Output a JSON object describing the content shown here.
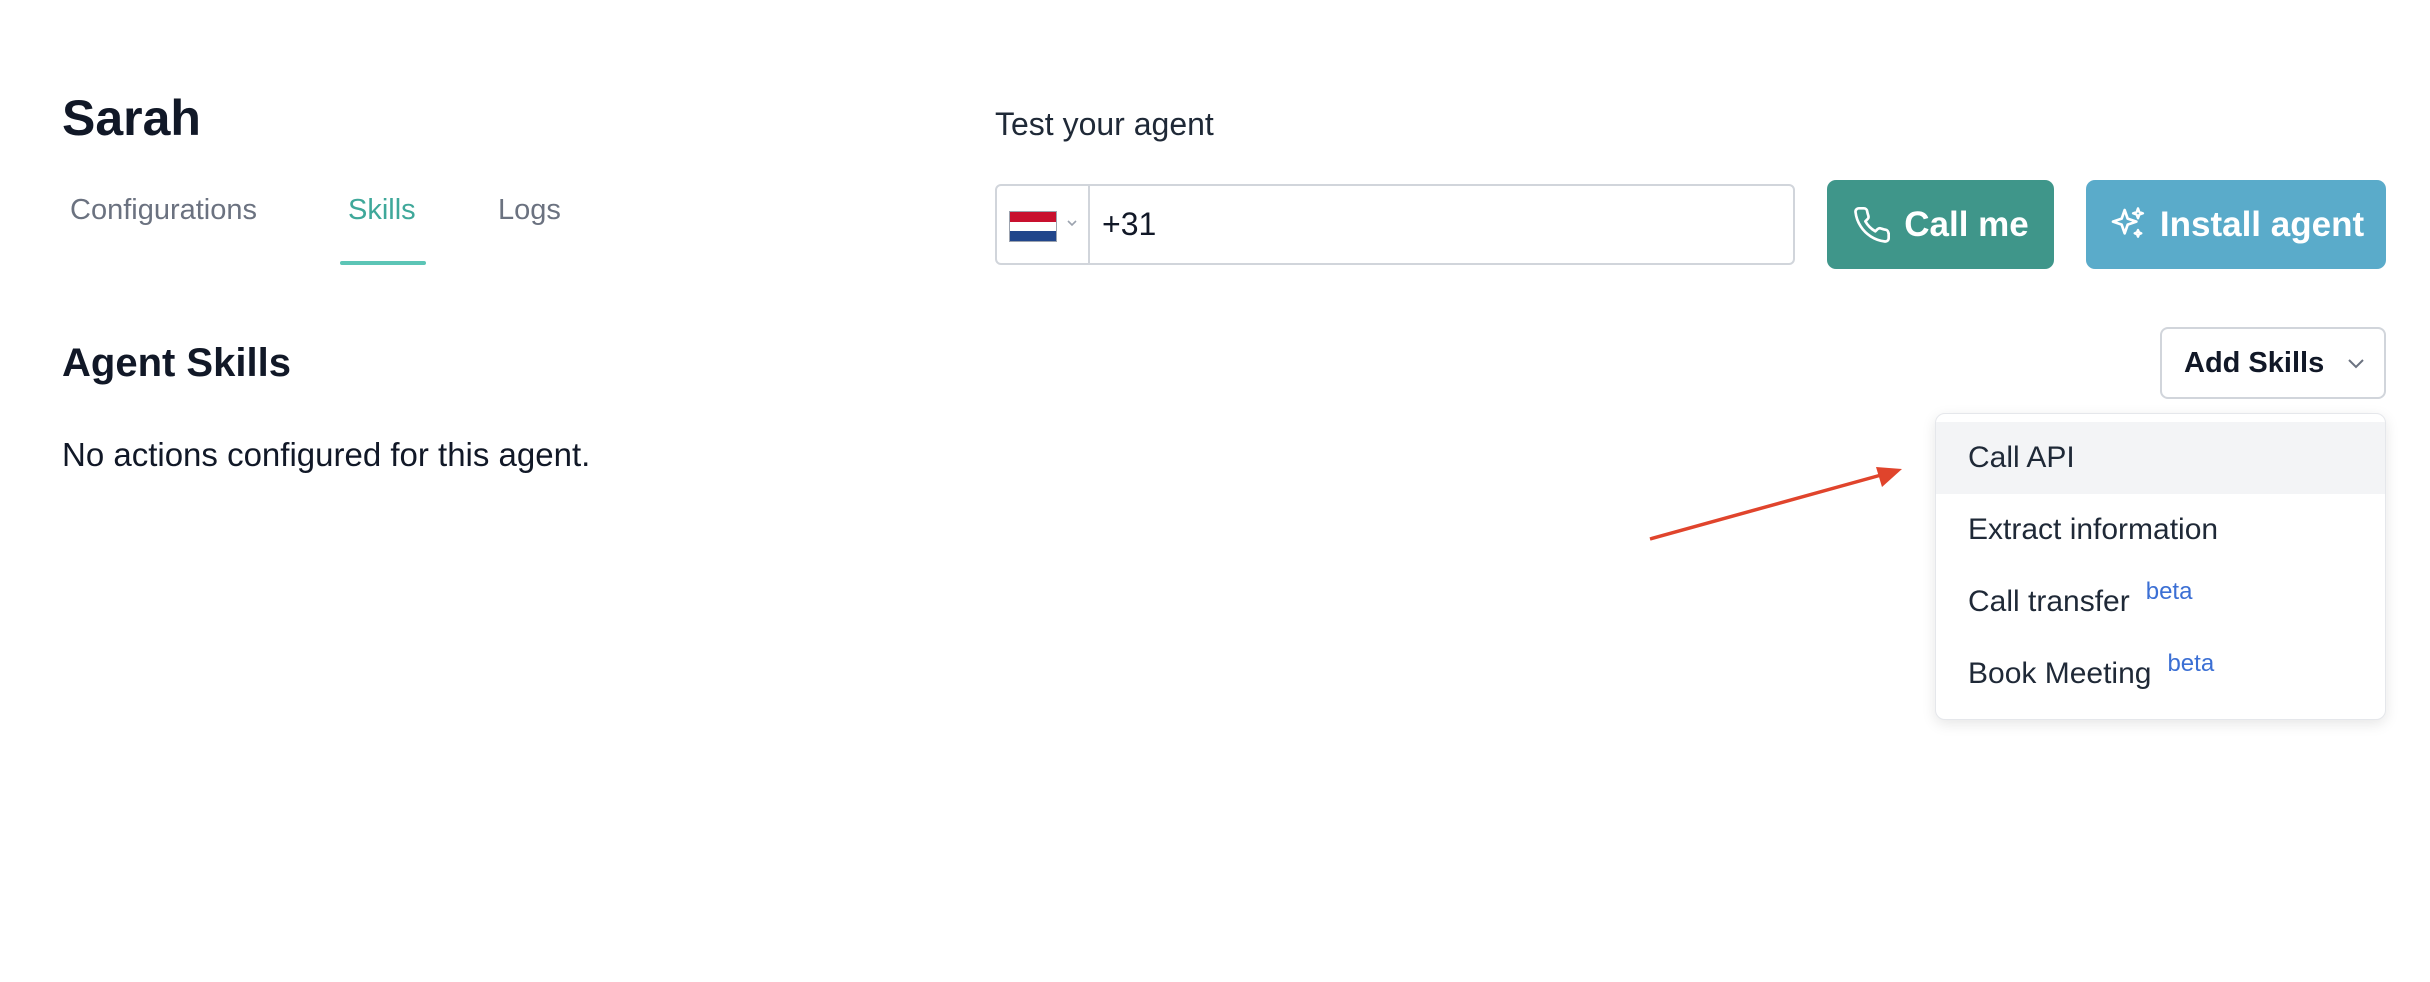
{
  "agent": {
    "name": "Sarah"
  },
  "tabs": [
    {
      "label": "Configurations",
      "active": false
    },
    {
      "label": "Skills",
      "active": true
    },
    {
      "label": "Logs",
      "active": false
    }
  ],
  "test": {
    "title": "Test your agent",
    "country_flag": "netherlands-flag-icon",
    "phone_value": "+31",
    "call_button_label": "Call me",
    "install_button_label": "Install agent"
  },
  "skills": {
    "title": "Agent Skills",
    "empty_message": "No actions configured for this agent.",
    "add_button_label": "Add Skills",
    "menu_items": [
      {
        "label": "Call API",
        "badge": ""
      },
      {
        "label": "Extract information",
        "badge": ""
      },
      {
        "label": "Call transfer",
        "badge": "beta"
      },
      {
        "label": "Book Meeting",
        "badge": "beta"
      }
    ]
  },
  "colors": {
    "accent_teal": "#3f968a",
    "accent_blue": "#5aabca",
    "active_tab": "#3fa89a",
    "beta_badge": "#3b6fd4",
    "annotation_arrow": "#e0442c"
  }
}
